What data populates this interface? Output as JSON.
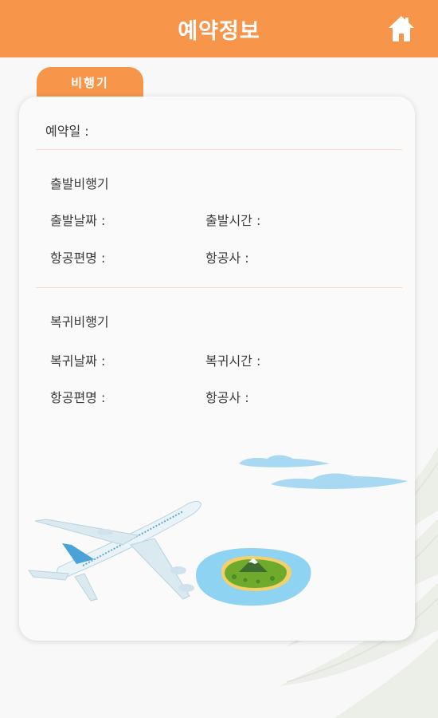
{
  "header": {
    "title": "예약정보",
    "home_icon": "home-icon"
  },
  "tab": {
    "label": "비행기"
  },
  "booking": {
    "reservation_date_label": "예약일 :"
  },
  "departure": {
    "section_title": "출발비행기",
    "date_label": "출발날짜 :",
    "time_label": "출발시간 :",
    "flight_label": "항공편명 :",
    "airline_label": "항공사 :"
  },
  "return": {
    "section_title": "복귀비행기",
    "date_label": "복귀날짜 :",
    "time_label": "복귀시간 :",
    "flight_label": "항공편명 :",
    "airline_label": "항공사 :"
  },
  "colors": {
    "accent": "#f7954a",
    "divider": "#fbdcc8",
    "card": "#fafafa",
    "background": "#f8f8f8"
  }
}
